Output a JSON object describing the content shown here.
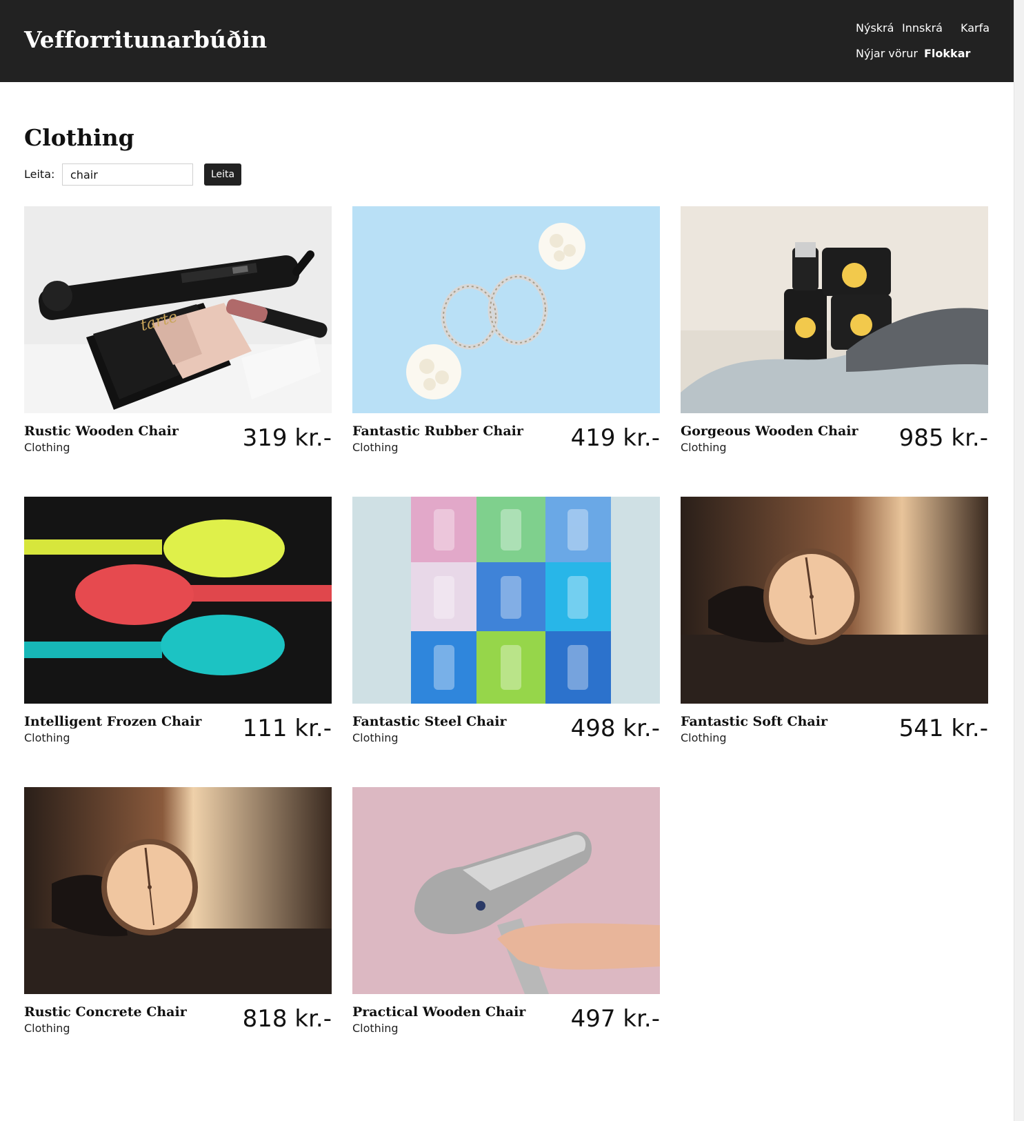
{
  "header": {
    "brand": "Vefforritunarbúðin",
    "nav": {
      "register": "Nýskrá",
      "login": "Innskrá",
      "cart": "Karfa",
      "new_products": "Nýjar vörur",
      "categories": "Flokkar"
    }
  },
  "main": {
    "title": "Clothing",
    "search": {
      "label": "Leita:",
      "value": "chair",
      "button": "Leita"
    },
    "products": [
      {
        "title": "Rustic Wooden Chair",
        "category": "Clothing",
        "price": "319 kr.-",
        "image": "hair-straightener-and-makeup-palette"
      },
      {
        "title": "Fantastic Rubber Chair",
        "category": "Clothing",
        "price": "419 kr.-",
        "image": "earrings-with-white-flowers"
      },
      {
        "title": "Gorgeous Wooden Chair",
        "category": "Clothing",
        "price": "985 kr.-",
        "image": "cosmetic-jars-on-towel"
      },
      {
        "title": "Intelligent Frozen Chair",
        "category": "Clothing",
        "price": "111 kr.-",
        "image": "colorful-spoons"
      },
      {
        "title": "Fantastic Steel Chair",
        "category": "Clothing",
        "price": "498 kr.-",
        "image": "pop-art-color-grid"
      },
      {
        "title": "Fantastic Soft Chair",
        "category": "Clothing",
        "price": "541 kr.-",
        "image": "wristwatch"
      },
      {
        "title": "Rustic Concrete Chair",
        "category": "Clothing",
        "price": "818 kr.-",
        "image": "wristwatch"
      },
      {
        "title": "Practical Wooden Chair",
        "category": "Clothing",
        "price": "497 kr.-",
        "image": "hair-dryer"
      }
    ]
  },
  "colors": {
    "header_bg": "#222222",
    "header_text": "#ffffff",
    "button_bg": "#222222"
  }
}
